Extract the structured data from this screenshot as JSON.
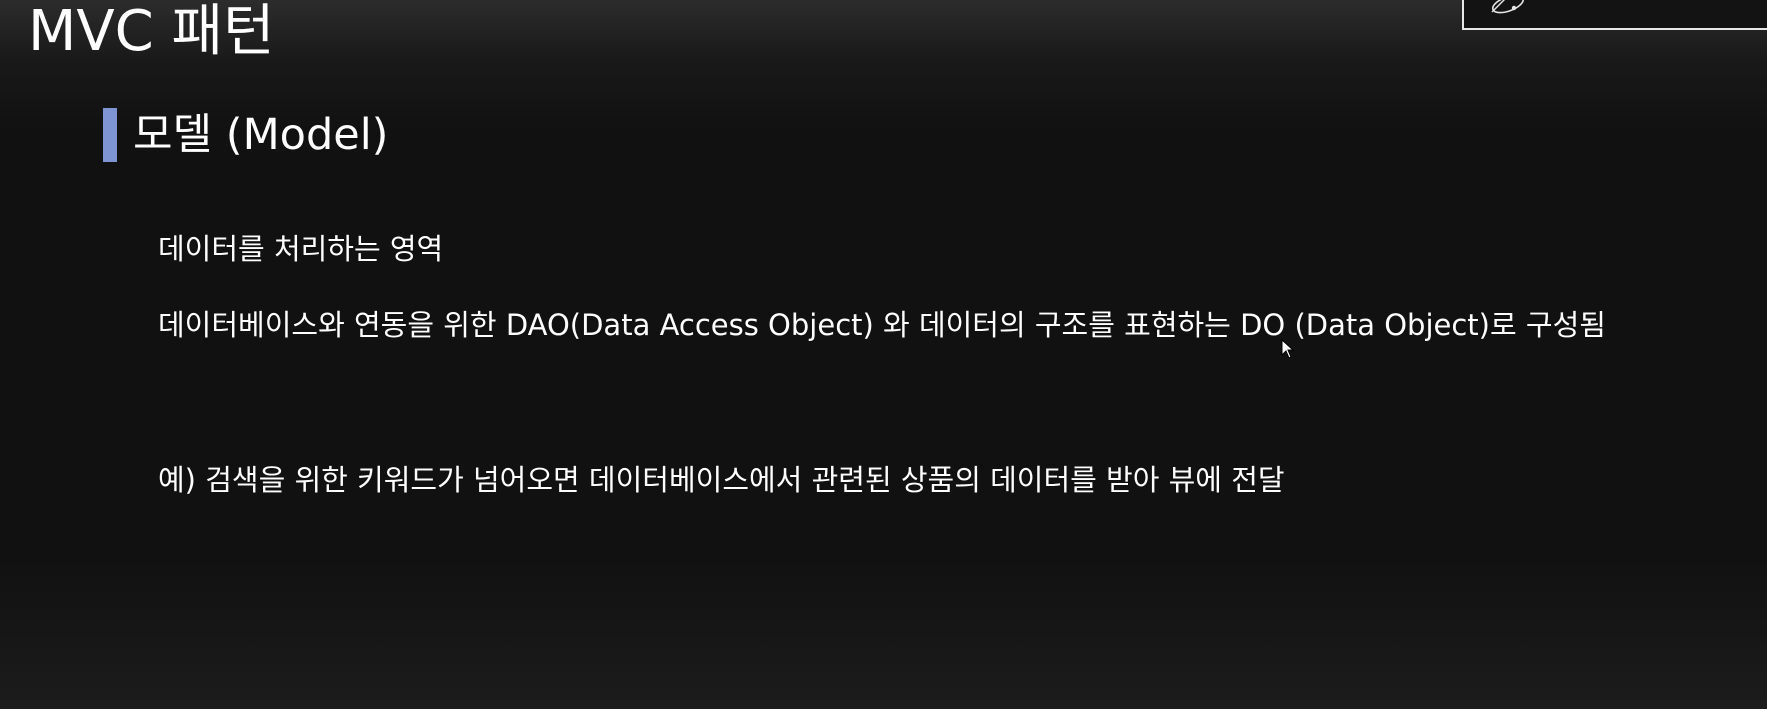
{
  "slide": {
    "title": "MVC 패턴",
    "section": {
      "heading": "모델 (Model)",
      "accent_color": "#7f95d3"
    },
    "lines": [
      "데이터를 처리하는 영역",
      "데이터베이스와 연동을 위한 DAO(Data Access Object) 와 데이터의 구조를 표현하는 DO (Data Object)로 구성됨",
      "예) 검색을 위한 키워드가 넘어오면 데이터베이스에서 관련된 상품의 데이터를 받아 뷰에 전달"
    ]
  },
  "icons": {
    "logo": "orbit-logo-icon",
    "cursor": "mouse-pointer-icon"
  },
  "colors": {
    "background": "#111111",
    "text": "#ffffff"
  }
}
